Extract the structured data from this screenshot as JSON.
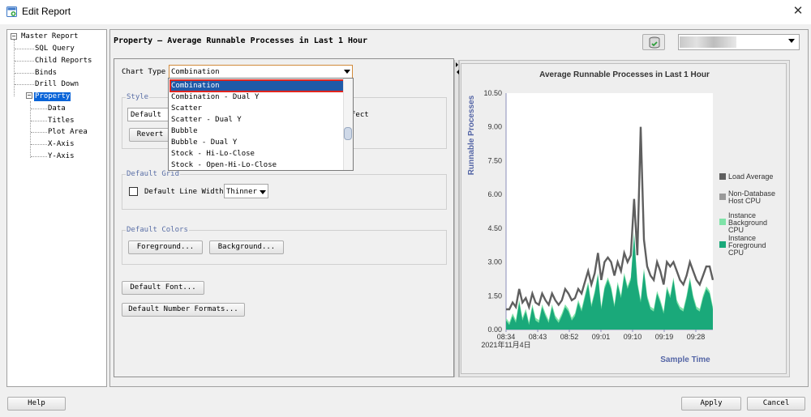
{
  "window": {
    "title": "Edit Report",
    "close_glyph": "✕"
  },
  "tree": {
    "root": "Master Report",
    "items": [
      {
        "label": "SQL Query"
      },
      {
        "label": "Child Reports"
      },
      {
        "label": "Binds"
      },
      {
        "label": "Drill Down"
      },
      {
        "label": "Property",
        "selected": true
      }
    ],
    "property_children": [
      {
        "label": "Data"
      },
      {
        "label": "Titles"
      },
      {
        "label": "Plot Area"
      },
      {
        "label": "X-Axis"
      },
      {
        "label": "Y-Axis"
      }
    ]
  },
  "header": {
    "title": "Property — Average Runnable Processes in Last 1 Hour"
  },
  "settings": {
    "chart_type_label": "Chart Type",
    "chart_type_value": "Combination",
    "style_group": "Style",
    "style_value": "Default",
    "effect_suffix": "fect",
    "revert_button": "Revert",
    "grid_group": "Default Grid",
    "default_line_width_label": "Default Line Width",
    "line_width_value": "Thinner",
    "colors_group": "Default Colors",
    "foreground_button": "Foreground...",
    "background_button": "Background...",
    "default_font_button": "Default Font...",
    "default_number_formats_button": "Default Number Formats..."
  },
  "dropdown": {
    "options": [
      "Combination",
      "Combination - Dual Y",
      "Scatter",
      "Scatter - Dual Y",
      "Bubble",
      "Bubble - Dual Y",
      "Stock - Hi-Lo-Close",
      "Stock - Open-Hi-Lo-Close"
    ],
    "selected_index": 0
  },
  "footer": {
    "help": "Help",
    "apply": "Apply",
    "cancel": "Cancel"
  },
  "colors": {
    "load_average": "#5f5f5f",
    "non_db_host_cpu": "#9a9a9a",
    "bg_cpu": "#7fe3a8",
    "fg_cpu": "#1aa97a",
    "axis_label": "#5566a6",
    "title_bar_select": "#0a64d8"
  },
  "chart_data": {
    "type": "area",
    "title": "Average Runnable Processes in Last 1 Hour",
    "ylabel": "Runnable Processes",
    "xlabel": "Sample Time",
    "ylim": [
      0,
      10.5
    ],
    "yticks": [
      "10.50",
      "9.00",
      "7.50",
      "6.00",
      "4.50",
      "3.00",
      "1.50",
      "0.00"
    ],
    "xticks": [
      "08:34",
      "08:43",
      "08:52",
      "09:01",
      "09:10",
      "09:19",
      "09:28"
    ],
    "date_label": "2021年11月4日",
    "legend": [
      "Load Average",
      "Non-Database Host CPU",
      "Instance Background CPU",
      "Instance Foreground CPU"
    ],
    "series": [
      {
        "name": "Load Average",
        "values": [
          0.9,
          0.9,
          1.2,
          1.0,
          1.8,
          1.2,
          1.4,
          1.0,
          1.6,
          1.2,
          1.1,
          1.6,
          1.3,
          1.1,
          1.6,
          1.3,
          1.1,
          1.3,
          1.8,
          1.6,
          1.3,
          1.4,
          1.8,
          1.6,
          2.1,
          2.6,
          2.0,
          2.5,
          3.4,
          2.2,
          3.0,
          3.2,
          3.0,
          2.4,
          3.0,
          2.6,
          3.4,
          3.0,
          3.3,
          5.8,
          3.3,
          9.0,
          4.0,
          2.8,
          2.4,
          2.2,
          3.0,
          2.6,
          2.0,
          3.0,
          2.8,
          3.0,
          2.6,
          2.2,
          2.0,
          2.4,
          3.0,
          2.6,
          2.2,
          2.0,
          2.4,
          2.8,
          2.8,
          2.2
        ]
      },
      {
        "name": "Instance Foreground CPU",
        "values": [
          0.4,
          0.2,
          0.6,
          0.3,
          1.2,
          0.4,
          0.8,
          0.2,
          1.0,
          0.4,
          0.3,
          1.0,
          0.6,
          0.3,
          1.0,
          0.5,
          0.3,
          0.6,
          1.0,
          0.8,
          0.4,
          0.6,
          1.2,
          0.8,
          1.4,
          2.0,
          1.0,
          1.6,
          2.4,
          0.9,
          1.8,
          2.2,
          1.8,
          1.0,
          2.0,
          1.4,
          2.4,
          1.8,
          2.2,
          4.2,
          2.0,
          1.2,
          2.6,
          1.4,
          0.9,
          0.8,
          1.6,
          1.2,
          0.7,
          1.8,
          1.4,
          2.2,
          1.2,
          0.9,
          0.8,
          1.4,
          2.2,
          1.4,
          0.9,
          0.8,
          1.4,
          1.8,
          1.6,
          0.9
        ]
      }
    ]
  }
}
